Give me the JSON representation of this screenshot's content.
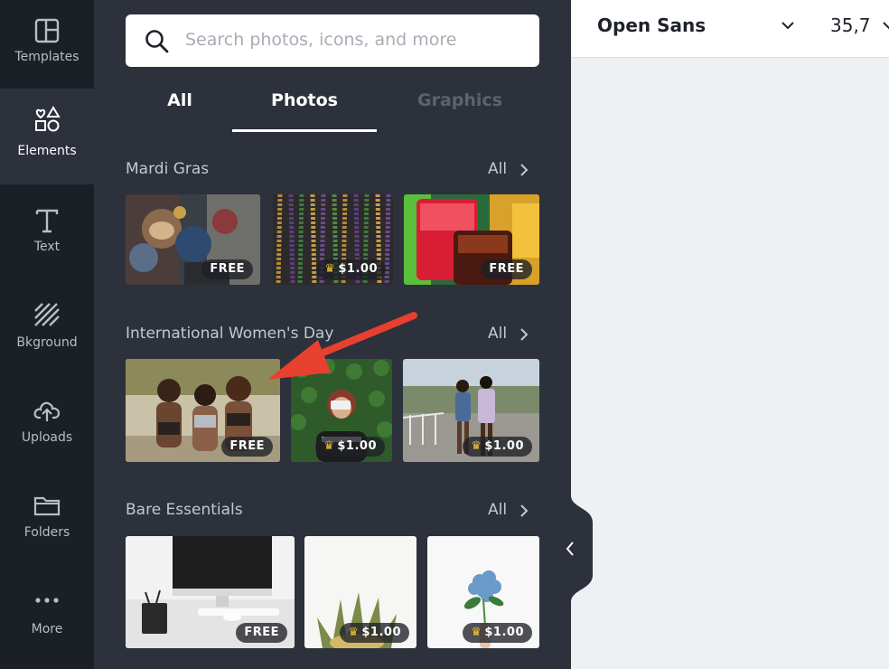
{
  "sidebar": {
    "items": [
      {
        "label": "Templates",
        "icon": "templates-icon"
      },
      {
        "label": "Elements",
        "icon": "elements-icon"
      },
      {
        "label": "Text",
        "icon": "text-icon"
      },
      {
        "label": "Bkground",
        "icon": "background-icon"
      },
      {
        "label": "Uploads",
        "icon": "upload-cloud-icon"
      },
      {
        "label": "Folders",
        "icon": "folder-icon"
      },
      {
        "label": "More",
        "icon": "more-dots-icon"
      }
    ]
  },
  "search": {
    "placeholder": "Search photos, icons, and more"
  },
  "tabs": [
    {
      "label": "All"
    },
    {
      "label": "Photos"
    },
    {
      "label": "Graphics"
    }
  ],
  "sections": [
    {
      "title": "Mardi Gras",
      "all_label": "All",
      "items": [
        {
          "subject": "carnival masks",
          "badge": "FREE",
          "premium": false
        },
        {
          "subject": "bead necklaces",
          "badge": "$1.00",
          "premium": true
        },
        {
          "subject": "colorful drinks",
          "badge": "FREE",
          "premium": false
        }
      ]
    },
    {
      "title": "International Women's Day",
      "all_label": "All",
      "items": [
        {
          "subject": "three women",
          "badge": "FREE",
          "premium": false
        },
        {
          "subject": "woman with camera",
          "badge": "$1.00",
          "premium": true
        },
        {
          "subject": "two women walking",
          "badge": "$1.00",
          "premium": true
        }
      ]
    },
    {
      "title": "Bare Essentials",
      "all_label": "All",
      "items": [
        {
          "subject": "desk with monitor",
          "badge": "FREE",
          "premium": false
        },
        {
          "subject": "pineapple",
          "badge": "$1.00",
          "premium": true
        },
        {
          "subject": "blue flower",
          "badge": "$1.00",
          "premium": true
        }
      ]
    }
  ],
  "toolbar": {
    "font_name": "Open Sans",
    "font_size": "35,7"
  },
  "colors": {
    "rail_bg": "#1b1f26",
    "panel_bg": "#2c313b",
    "canvas_bg": "#eef1f4",
    "annotation_arrow": "#e8402e",
    "crown": "#f2c230"
  }
}
